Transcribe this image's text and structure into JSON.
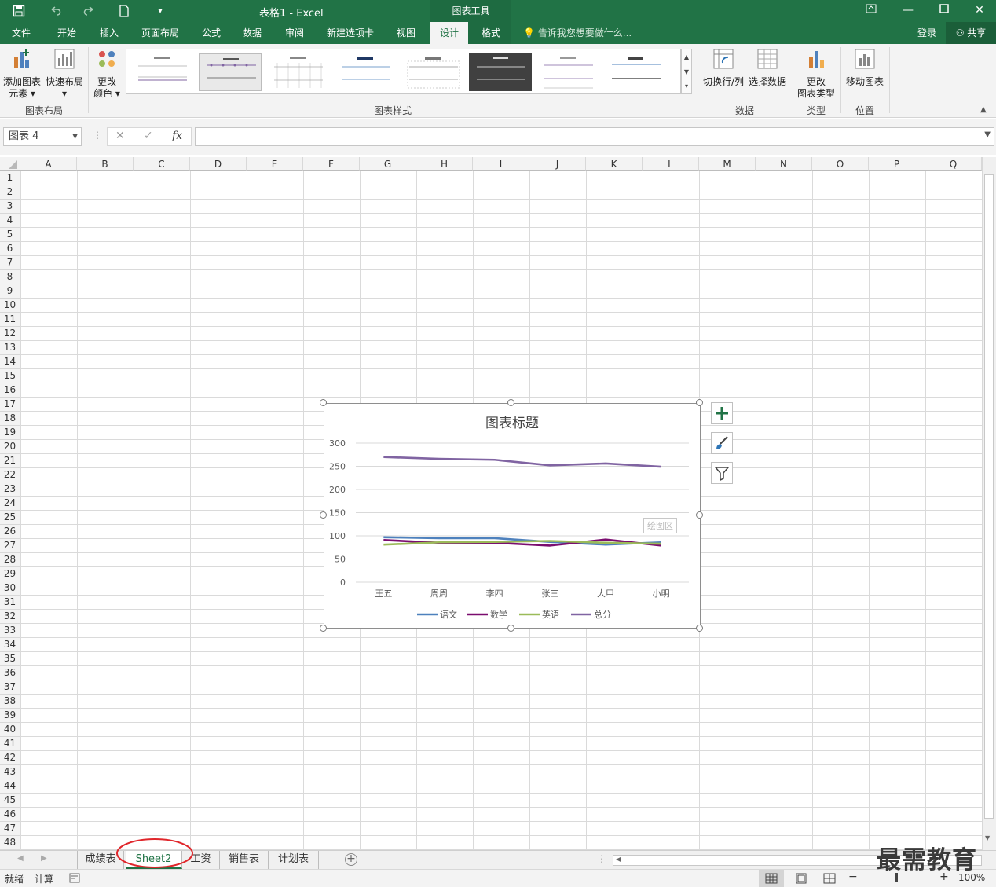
{
  "window": {
    "title": "表格1 - Excel",
    "context_tab": "图表工具"
  },
  "ribbon_tabs": [
    "文件",
    "开始",
    "插入",
    "页面布局",
    "公式",
    "数据",
    "审阅",
    "新建选项卡",
    "视图",
    "设计",
    "格式"
  ],
  "active_tab": "设计",
  "tell_me": "告诉我您想要做什么...",
  "account": {
    "login": "登录",
    "share": "共享"
  },
  "ribbon": {
    "add_element": [
      "添加图表",
      "元素 ▾"
    ],
    "quick_layout": [
      "快速布局",
      "▾"
    ],
    "change_color": [
      "更改",
      "颜色 ▾"
    ],
    "group_layouts": "图表布局",
    "group_styles": "图表样式",
    "switch_rowcol": "切换行/列",
    "select_data": "选择数据",
    "group_data": "数据",
    "change_type": [
      "更改",
      "图表类型"
    ],
    "group_type": "类型",
    "move_chart": "移动图表",
    "group_location": "位置"
  },
  "name_box": "图表 4",
  "formula_icons": {
    "cancel": "✕",
    "enter": "✓",
    "fx": "fx"
  },
  "columns": [
    "A",
    "B",
    "C",
    "D",
    "E",
    "F",
    "G",
    "H",
    "I",
    "J",
    "K",
    "L",
    "M",
    "N",
    "O",
    "P",
    "Q"
  ],
  "rows": [
    "1",
    "2",
    "3",
    "4",
    "5",
    "6",
    "7",
    "8",
    "9",
    "10",
    "11",
    "12",
    "13",
    "14",
    "15",
    "16",
    "17",
    "18",
    "19",
    "20",
    "21",
    "22",
    "23",
    "24",
    "25",
    "26",
    "27",
    "28",
    "29",
    "30",
    "31",
    "32",
    "33",
    "34",
    "35",
    "36",
    "37",
    "38",
    "39",
    "40",
    "41",
    "42",
    "43",
    "44",
    "45",
    "46",
    "47",
    "48"
  ],
  "chart_data": {
    "type": "line",
    "title": "图表标题",
    "categories": [
      "王五",
      "周周",
      "李四",
      "张三",
      "大甲",
      "小明"
    ],
    "series": [
      {
        "name": "语文",
        "color": "#4e81bd",
        "values": [
          97,
          95,
          95,
          87,
          81,
          86
        ]
      },
      {
        "name": "数学",
        "color": "#7b0d6f",
        "values": [
          91,
          85,
          85,
          79,
          92,
          79
        ]
      },
      {
        "name": "英语",
        "color": "#9bbb59",
        "values": [
          81,
          86,
          87,
          89,
          85,
          83
        ]
      },
      {
        "name": "总分",
        "color": "#8064a2",
        "values": [
          270,
          266,
          264,
          252,
          256,
          249
        ]
      }
    ],
    "yticks": [
      "300",
      "250",
      "200",
      "150",
      "100",
      "50",
      "0"
    ],
    "ylim": [
      0,
      300
    ],
    "tooltip": "绘图区",
    "grid": true,
    "legend_position": "bottom"
  },
  "sheets": [
    "成绩表",
    "Sheet2",
    "工资",
    "销售表",
    "计划表"
  ],
  "active_sheet": "Sheet2",
  "status": {
    "ready": "就绪",
    "calc": "计算",
    "zoom": "100%"
  },
  "watermark": "最需教育",
  "colors": {
    "excel_green": "#217346",
    "annotation_red": "#e0262b"
  }
}
